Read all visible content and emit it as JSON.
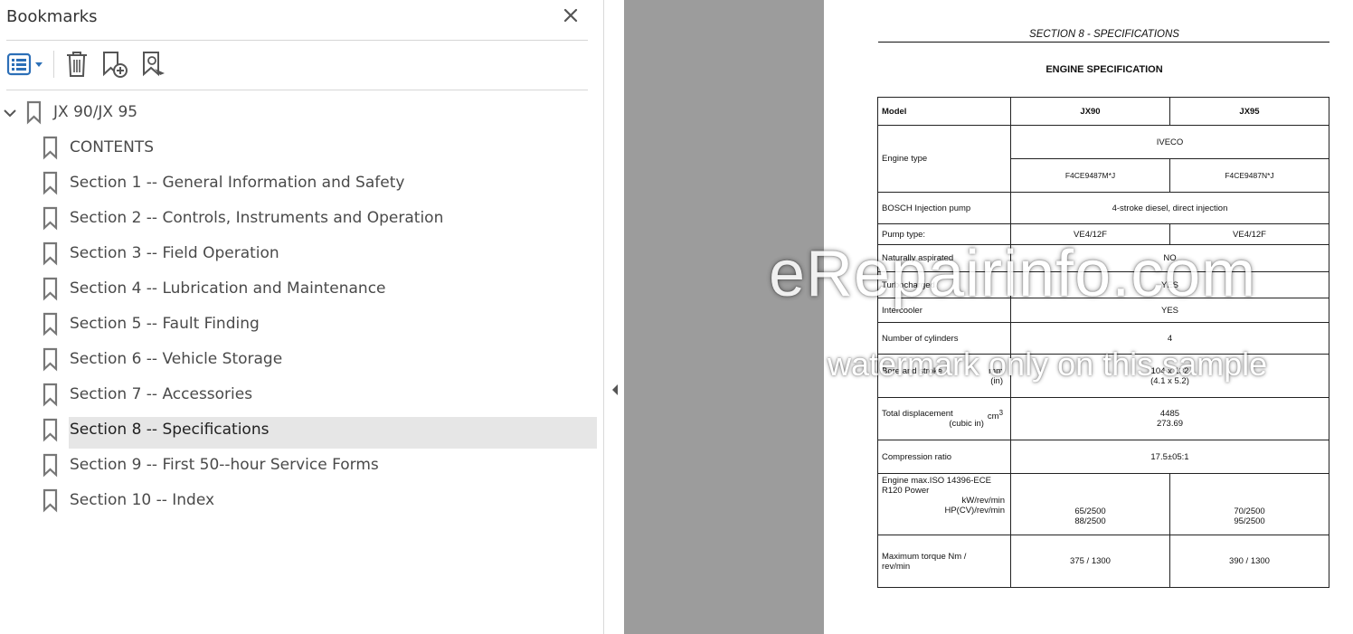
{
  "panel": {
    "title": "Bookmarks",
    "close_icon": "close-icon",
    "toolbar": {
      "options_icon": "bookmark-options-icon",
      "delete_icon": "delete-trash-icon",
      "new_bookmark_icon": "new-bookmark-icon",
      "find_bookmark_icon": "find-current-bookmark-icon"
    },
    "root": {
      "label": "JX 90/JX 95",
      "expanded": true
    },
    "items": [
      {
        "label": "CONTENTS"
      },
      {
        "label": "Section 1 -- General Information and Safety"
      },
      {
        "label": "Section 2 -- Controls, Instruments and Operation"
      },
      {
        "label": "Section 3 -- Field Operation"
      },
      {
        "label": "Section 4 -- Lubrication and Maintenance"
      },
      {
        "label": "Section 5 -- Fault Finding"
      },
      {
        "label": "Section 6 -- Vehicle Storage"
      },
      {
        "label": "Section 7 -- Accessories"
      },
      {
        "label": "Section 8 -- Specifications",
        "selected": true
      },
      {
        "label": "Section 9 -- First 50--hour Service Forms"
      },
      {
        "label": "Section 10 -- Index"
      }
    ]
  },
  "document": {
    "section_header": "SECTION 8  -  SPECIFICATIONS",
    "title": "ENGINE SPECIFICATION",
    "table": {
      "model_label": "Model",
      "col1": "JX90",
      "col2": "JX95",
      "engine_type_label": "Engine type",
      "engine_make": "IVECO",
      "engine_code1": "F4CE9487M*J",
      "engine_code2": "F4CE9487N*J",
      "injection_pump_label": "BOSCH Injection pump",
      "injection_value": "4-stroke diesel, direct injection",
      "pump_type_label": "Pump type:",
      "pump_type1": "VE4/12F",
      "pump_type2": "VE4/12F",
      "naturally_aspirated_label": "Naturally aspirated",
      "naturally_aspirated_value": "NO",
      "turbocharged_label": "Turbocharged",
      "turbocharged_value": "YES",
      "intercooler_label": "Intercooler",
      "intercooler_value": "YES",
      "cylinders_label": "Number of cylinders",
      "cylinders_value": "4",
      "bore_label": "Bore and stroke",
      "bore_unit_mm": "mm",
      "bore_unit_in": "(in)",
      "bore_value_mm": "104 x 132",
      "bore_value_in": "(4.1 x 5.2)",
      "displacement_label": "Total displacement",
      "displacement_unit": "cm",
      "displacement_unit_sup": "3",
      "displacement_unit_in": "(cubic in)",
      "displacement_cm3": "4485",
      "displacement_in": "273.69",
      "compression_label": "Compression ratio",
      "compression_value": "17.5±05:1",
      "power_label_1": "Engine max.ISO 14396-ECE",
      "power_label_2": "R120 Power",
      "power_unit_kw": "kW/rev/min",
      "power_unit_hp": "HP(CV)/rev/min",
      "power_kw_1": "65/2500",
      "power_hp_1": "88/2500",
      "power_kw_2": "70/2500",
      "power_hp_2": "95/2500",
      "torque_label_1": "Maximum torque  Nm /",
      "torque_label_2": "rev/min",
      "torque_1": "375 / 1300",
      "torque_2": "390 / 1300"
    }
  },
  "watermark": {
    "line1": "eRepairinfo.com",
    "line2": "watermark only on this sample"
  }
}
